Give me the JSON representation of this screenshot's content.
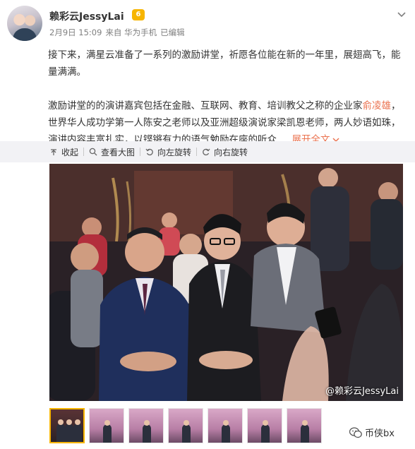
{
  "post": {
    "user_name": "赖彩云JessyLai",
    "vip_badge": "6",
    "date": "2月9日 15:09",
    "source": "来自 华为手机",
    "edited": "已编辑",
    "paragraph1": "接下来，满星云准备了一系列的激励讲堂，祈愿各位能在新的一年里，展翅高飞，能量满满。",
    "paragraph2_a": "激励讲堂的的演讲嘉宾包括在金融、互联网、教育、培训教父之称的企业家",
    "paragraph2_highlight": "俞凌雄",
    "paragraph2_b": "，世界华人成功学第一人陈安之老师以及亚洲超级演说家梁凯恩老师，两人妙语如珠，演讲内容丰富扎实，以铿锵有力的语气勉励在座的听众 ...",
    "expand_label": "展开全文"
  },
  "toolbar": {
    "collapse": "收起",
    "view_large": "查看大图",
    "rotate_left": "向左旋转",
    "rotate_right": "向右旋转"
  },
  "photo": {
    "watermark": "@赖彩云JessyLai"
  },
  "thumbnails": {
    "count": 7,
    "active_index": 0
  },
  "branding": {
    "label": "币侠bx"
  },
  "colors": {
    "accent": "#eb7350",
    "vip": "#f7b500",
    "toolbar_bg": "#f2f2f5"
  }
}
